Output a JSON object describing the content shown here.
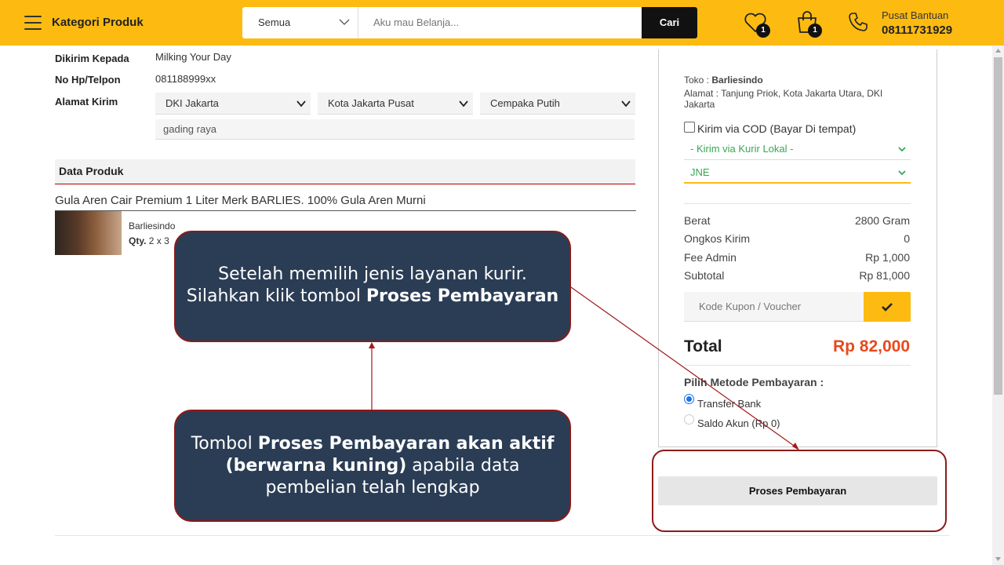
{
  "header": {
    "category_label": "Kategori Produk",
    "search_category": "Semua",
    "search_placeholder": "Aku mau Belanja...",
    "search_button": "Cari",
    "wishlist_count": "1",
    "cart_count": "1",
    "help_label": "Pusat Bantuan",
    "help_phone": "08111731929",
    "accent_color": "#fdbb12"
  },
  "shipping": {
    "recipient_label": "Dikirim Kepada",
    "recipient_value": "Milking Your Day",
    "phone_label": "No Hp/Telpon",
    "phone_value": "081188999xx",
    "address_label": "Alamat Kirim",
    "province": "DKI Jakarta",
    "city": "Kota Jakarta Pusat",
    "district": "Cempaka Putih",
    "street": "gading raya"
  },
  "product": {
    "section_title": "Data Produk",
    "name": "Gula Aren Cair Premium 1 Liter Merk BARLIES. 100% Gula Aren Murni",
    "store": "Barliesindo",
    "qty_label": "Qty.",
    "qty_value": "2 x 3"
  },
  "order": {
    "store_label": "Toko :",
    "store_name": "Barliesindo",
    "address": "Alamat : Tanjung Priok, Kota Jakarta Utara, DKI Jakarta",
    "cod_label": "Kirim via COD (Bayar Di tempat)",
    "courier_type": "- Kirim via Kurir Lokal -",
    "courier": "JNE",
    "rows": [
      {
        "label": "Berat",
        "value": "2800 Gram"
      },
      {
        "label": "Ongkos Kirim",
        "value": "0"
      },
      {
        "label": "Fee Admin",
        "value": "Rp 1,000"
      },
      {
        "label": "Subtotal",
        "value": "Rp 81,000"
      }
    ],
    "coupon_placeholder": "Kode Kupon / Voucher",
    "total_label": "Total",
    "total_value": "Rp 82,000",
    "payment_title": "Pilih Metode Pembayaran :",
    "payment_options": [
      "Transfer Bank",
      "Saldo Akun (Rp 0)"
    ],
    "pay_button": "Proses Pembayaran"
  },
  "callouts": {
    "top_line1": "Setelah memilih jenis layanan kurir.",
    "top_line2_pre": "Silahkan klik tombol ",
    "top_line2_bold": "Proses Pembayaran",
    "bottom_pre": "Tombol ",
    "bottom_bold1": "Proses Pembayaran akan aktif",
    "bottom_bold2": "(berwarna kuning)",
    "bottom_post": " apabila data",
    "bottom_line3": "pembelian telah lengkap"
  }
}
